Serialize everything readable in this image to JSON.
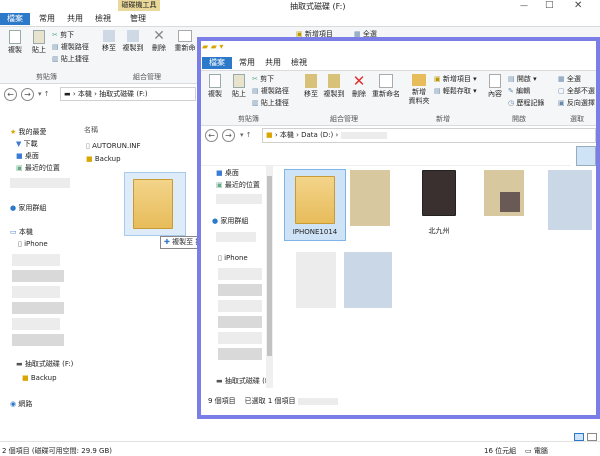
{
  "back_window": {
    "tool_tab": "磁碟機工具",
    "title": "抽取式磁碟 (F:)",
    "tabs": [
      "檔案",
      "常用",
      "共用",
      "檢視",
      "管理"
    ],
    "ribbon": {
      "copy": "複製",
      "paste": "貼上",
      "cut": "剪下",
      "copy_path": "複製路徑",
      "paste_shortcut": "貼上捷徑",
      "move_to": "移至",
      "copy_to": "複製到",
      "delete": "刪除",
      "rename": "重新命",
      "group_clipboard": "剪貼簿",
      "group_organize": "組合管理",
      "new_item": "新增項目",
      "select_all": "全選"
    },
    "address_prefix": "本機",
    "address_current": "抽取式磁碟 (F:)",
    "column_name": "名稱",
    "files": [
      "AUTORUN.INF",
      "Backup"
    ],
    "drag_tooltip": "複製至 抽取式磁碟 (F:)",
    "nav": {
      "favorites": "我的最愛",
      "downloads": "下載",
      "desktop": "桌面",
      "recent": "最近的位置",
      "homegroup": "家用群組",
      "this_pc": "本機",
      "iphone": "iPhone",
      "removable": "抽取式磁碟 (F:)",
      "backup": "Backup",
      "network": "網路"
    },
    "status_count": "2 個項目",
    "status_free": "(磁碟可用空間: 29.9 GB)",
    "status_size": "16 位元組",
    "status_computer": "電腦"
  },
  "front_window": {
    "tabs": [
      "檔案",
      "常用",
      "共用",
      "檢視"
    ],
    "ribbon": {
      "copy": "複製",
      "paste": "貼上",
      "cut": "剪下",
      "copy_path": "複製路徑",
      "paste_shortcut": "貼上捷徑",
      "move_to": "移至",
      "copy_to": "複製到",
      "delete": "刪除",
      "rename": "重新命名",
      "new_folder": "新增\n資料夾",
      "new_item": "新增項目",
      "easy_access": "輕鬆存取",
      "properties": "內容",
      "open": "開啟",
      "edit": "編輯",
      "history": "歷程記錄",
      "select_all": "全選",
      "select_none": "全部不選",
      "invert": "反向選擇",
      "group_clipboard": "剪貼簿",
      "group_organize": "組合管理",
      "group_new": "新增",
      "group_open": "開啟",
      "group_select": "選取"
    },
    "address_prefix": "本機",
    "address_current": "Data (D:)",
    "nav": {
      "desktop": "桌面",
      "recent": "最近的位置",
      "homegroup": "家用群組",
      "iphone": "iPhone",
      "removable": "抽取式磁碟 (F:)"
    },
    "items": [
      "IPHONE1014",
      "北九州"
    ],
    "status_count": "9 個項目",
    "status_selected": "已選取 1 個項目"
  },
  "colors": {
    "accent": "#2b79c8",
    "purple_frame": "#7a7ee6",
    "folder": "#e7bc5a"
  }
}
